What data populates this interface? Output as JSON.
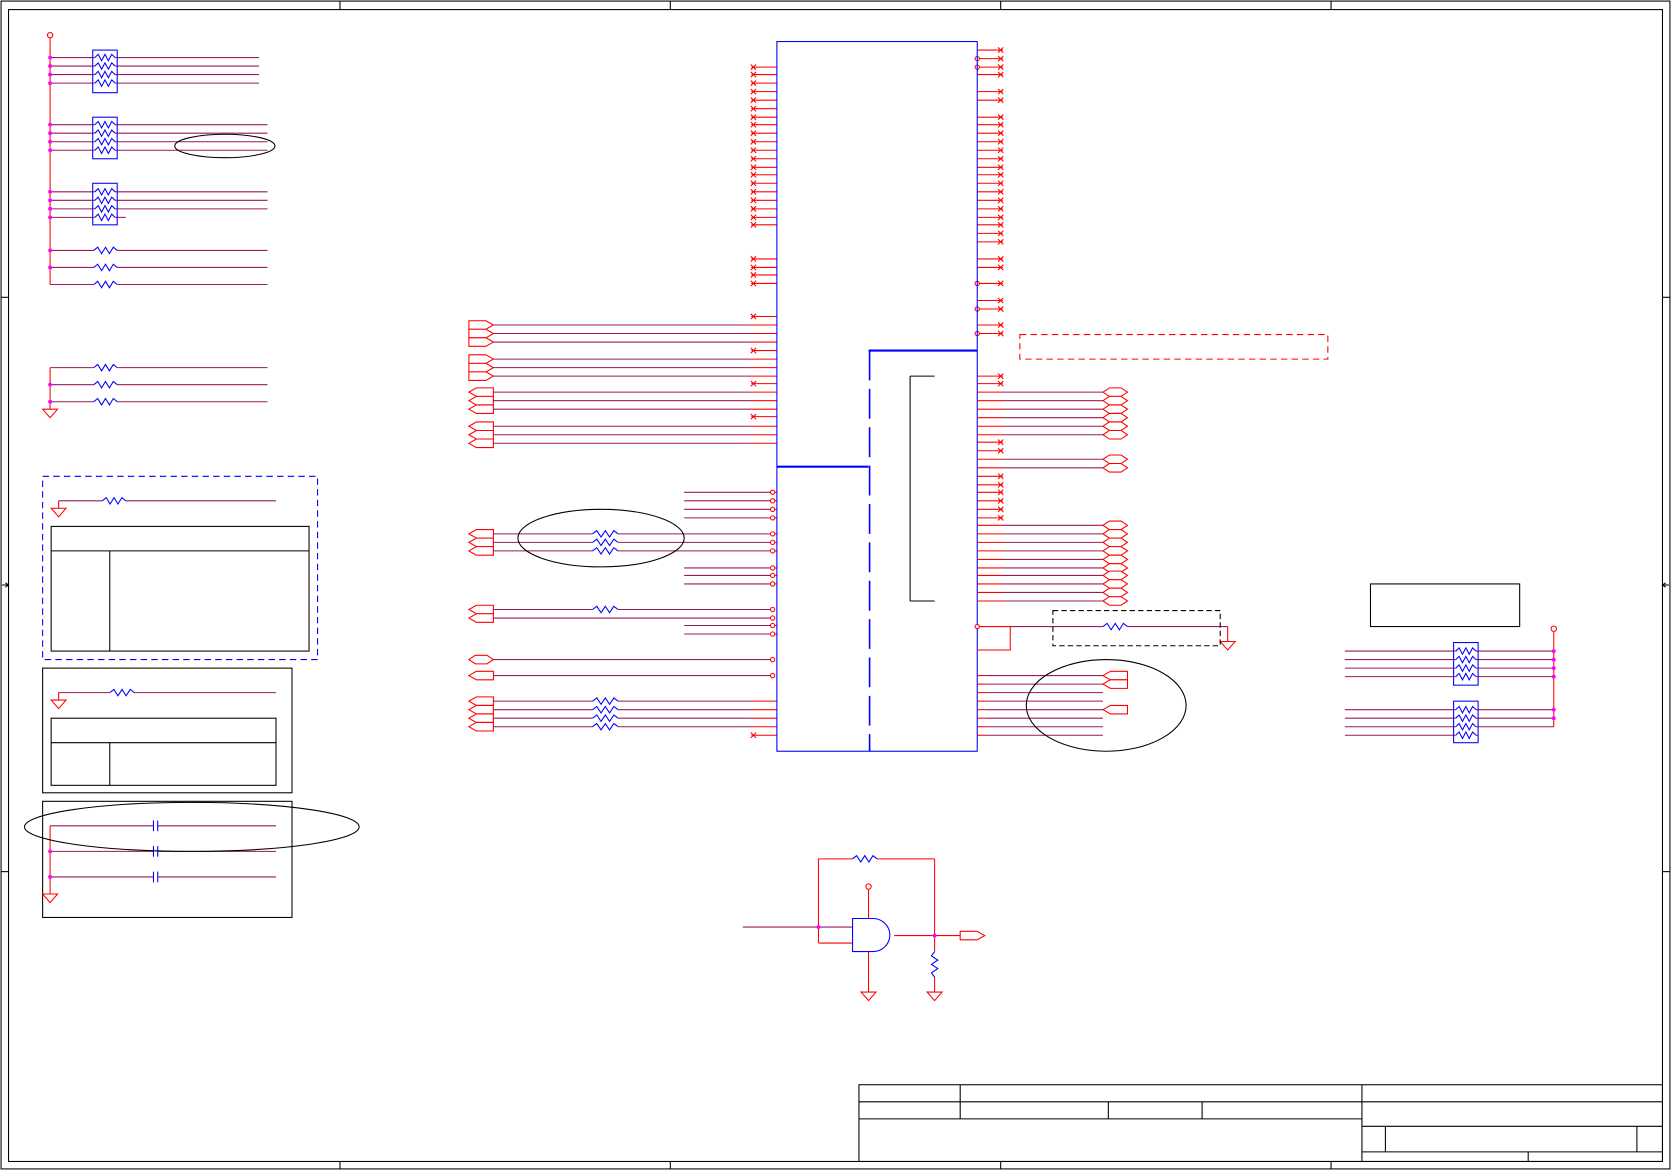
{
  "colors": {
    "background": "#ffffff",
    "frame": "#000000",
    "component": "#0000ff",
    "pin": "#ff0000",
    "net": "#9a1a5a",
    "junction": "#ff00ff",
    "annotation": "#000000",
    "highlight_box": "#ff0000"
  },
  "icons": {
    "resistor": "resistor-icon",
    "resistor_pack": "resistor-pack-icon",
    "capacitor": "capacitor-icon",
    "ground": "ground-icon",
    "power": "power-rail-icon",
    "and_gate": "and-gate-icon",
    "connector": "off-page-connector-icon",
    "no_connect": "no-connect-icon"
  }
}
